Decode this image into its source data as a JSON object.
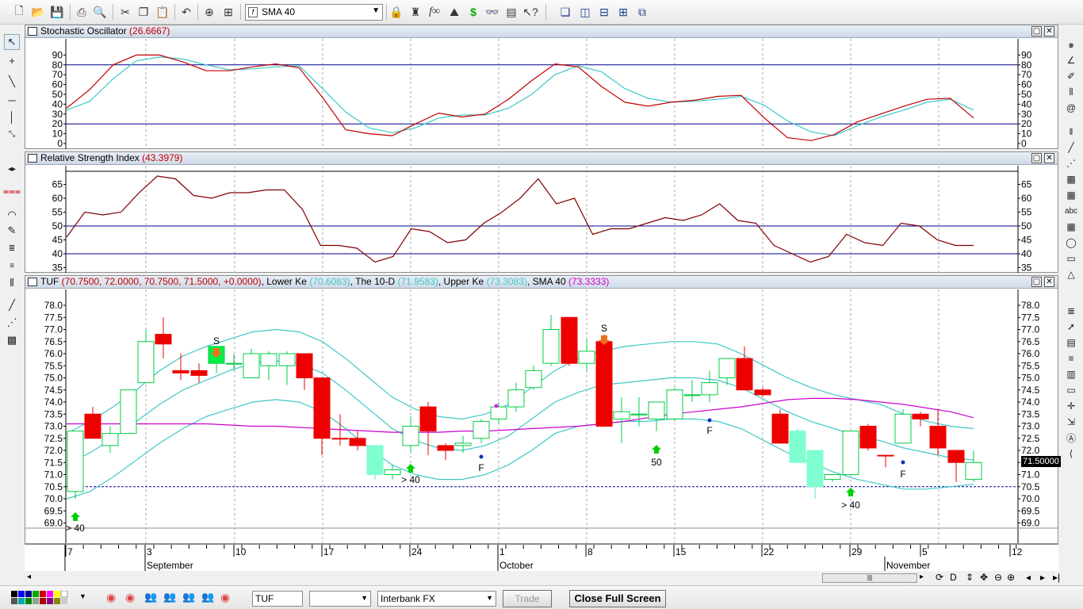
{
  "toolbar": {
    "indicator_select": "SMA 40",
    "icons": [
      "new-icon",
      "open-icon",
      "save-icon",
      "print-icon",
      "print-preview-icon",
      "cut-icon",
      "copy-icon",
      "paste-icon",
      "undo-icon",
      "crosshair-icon",
      "zoom-icon",
      "lock-icon",
      "stamp-icon",
      "function-icon",
      "chart-level-icon",
      "dollar-icon",
      "binoculars-icon",
      "properties-icon",
      "help-icon",
      "cascade-icon",
      "tile-vertical-icon",
      "tile-horizontal-icon",
      "tile-grid-icon",
      "layout-icon"
    ]
  },
  "stochastic": {
    "title": "Stochastic Oscillator",
    "value": "(26.6667)",
    "yticks": [
      "90",
      "80",
      "70",
      "60",
      "50",
      "40",
      "30",
      "20",
      "10",
      "0"
    ],
    "k_values": [
      36,
      55,
      80,
      90,
      90,
      83,
      74,
      74,
      78,
      81,
      77,
      47,
      14,
      10,
      8,
      20,
      31,
      27,
      30,
      45,
      64,
      81,
      78,
      58,
      42,
      38,
      42,
      44,
      48,
      49,
      26,
      6,
      3,
      9,
      22,
      30,
      38,
      45,
      46,
      26
    ],
    "d_values": [
      34,
      43,
      66,
      84,
      88,
      86,
      80,
      75,
      76,
      78,
      79,
      56,
      32,
      16,
      11,
      16,
      26,
      29,
      29,
      36,
      50,
      70,
      79,
      73,
      56,
      46,
      42,
      43,
      45,
      48,
      39,
      23,
      12,
      8,
      18,
      27,
      34,
      42,
      45,
      34
    ]
  },
  "rsi": {
    "title": "Relative Strength Index",
    "value": "(43.3979)",
    "yticks": [
      "65",
      "60",
      "55",
      "50",
      "45",
      "40",
      "35"
    ],
    "values": [
      46,
      55,
      54,
      55,
      62,
      68,
      67,
      61,
      60,
      62,
      62,
      63,
      63,
      56,
      43,
      43,
      42,
      37,
      39,
      49,
      48,
      44,
      45,
      51,
      55,
      60,
      67,
      58,
      60,
      47,
      49,
      49,
      51,
      53,
      52,
      54,
      58,
      52,
      51,
      43,
      40,
      37,
      39,
      47,
      44,
      43,
      51,
      50,
      45,
      43,
      43
    ]
  },
  "main": {
    "symbol": "TUF",
    "ohlc": "(70.7500, 72.0000, 70.7500, 71.5000, +0.0000)",
    "lower_label": "Lower Ke",
    "lower_value": "(70.6083)",
    "mid_label": "The 10-D",
    "mid_value": "(71.9583)",
    "upper_label": "Upper Ke",
    "upper_value": "(73.3083)",
    "sma_label": "SMA 40",
    "sma_value": "(73.3333)",
    "price_tag": "71.50000",
    "yticks": [
      "78.0",
      "77.5",
      "77.0",
      "76.5",
      "76.0",
      "75.5",
      "75.0",
      "74.5",
      "74.0",
      "73.5",
      "73.0",
      "72.5",
      "72.0",
      "71.5",
      "71.0",
      "70.5",
      "70.0",
      "69.5",
      "69.0"
    ],
    "annotations": {
      "s1": "S",
      "s2": "S",
      "a1": "> 40",
      "a2": "> 40",
      "a3": "> 40",
      "f1": "F",
      "f2": "F",
      "f3": "F",
      "n50": "50"
    }
  },
  "xaxis": {
    "day_ticks": [
      "7",
      "3",
      "10",
      "17",
      "24",
      "1",
      "8",
      "15",
      "22",
      "29",
      "5",
      "12"
    ],
    "months": [
      "September",
      "October",
      "November"
    ]
  },
  "status": {
    "symbol": "TUF",
    "blank_select": "",
    "feed": "Interbank FX",
    "trade_button": "Trade",
    "fullscreen_button": "Close Full Screen"
  },
  "colors": {
    "up": "#00cc44",
    "down": "#ee0000",
    "band": "#3fc7c7",
    "sma": "#cc00cc",
    "grid_level": "#00008b"
  }
}
